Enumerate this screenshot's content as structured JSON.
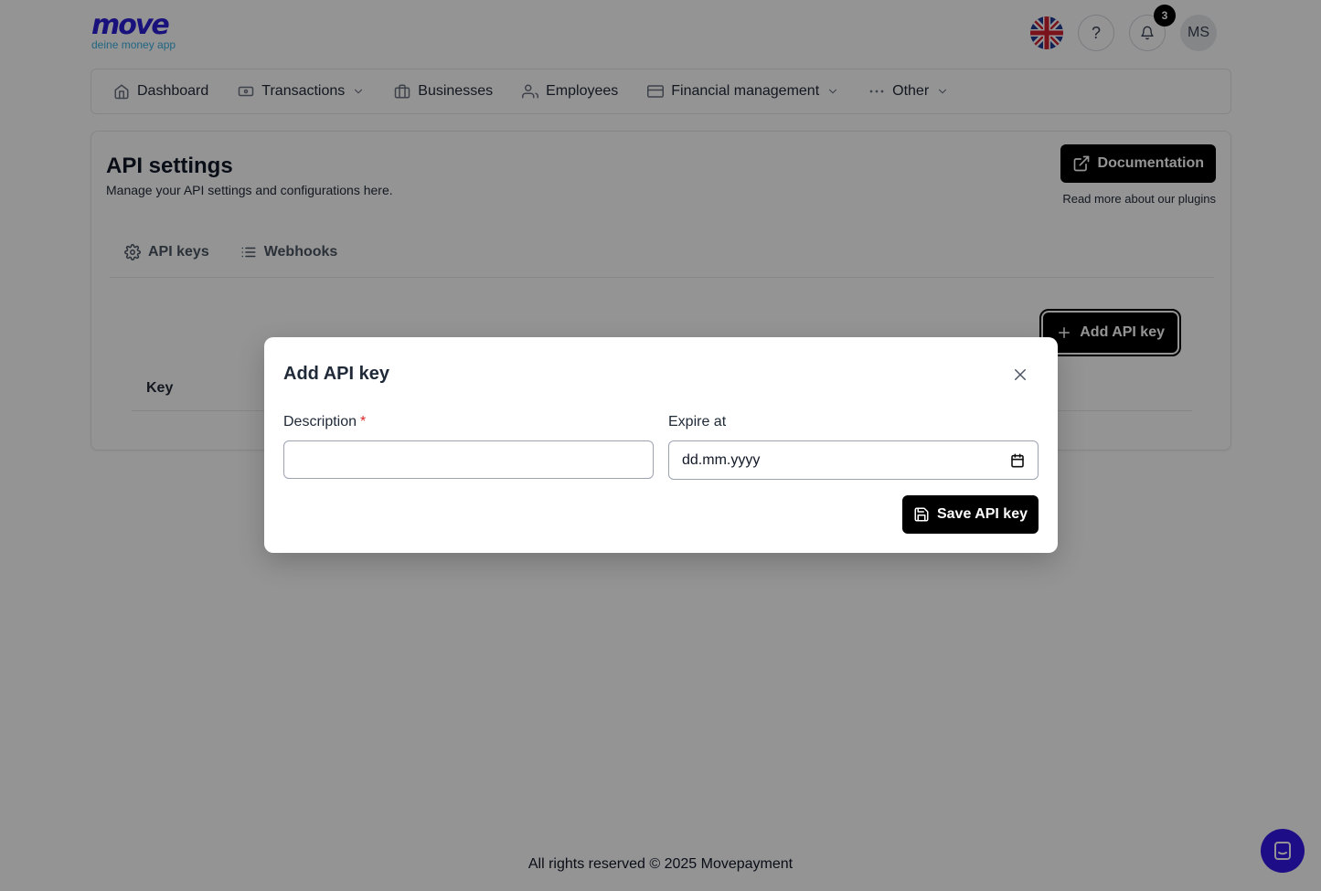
{
  "brand": {
    "name": "move",
    "tagline": "deine money app"
  },
  "header": {
    "language_icon": "uk-flag-icon",
    "help_label": "?",
    "notifications_count": "3",
    "avatar_initials": "MS"
  },
  "nav": {
    "items": [
      {
        "label": "Dashboard",
        "icon": "home-icon"
      },
      {
        "label": "Transactions",
        "icon": "banknote-icon"
      },
      {
        "label": "Businesses",
        "icon": "briefcase-icon"
      },
      {
        "label": "Employees",
        "icon": "users-icon"
      },
      {
        "label": "Financial management",
        "icon": "credit-card-icon"
      },
      {
        "label": "Other",
        "icon": "more-horizontal-icon"
      }
    ]
  },
  "page": {
    "title": "API settings",
    "subtitle": "Manage your API settings and configurations here.",
    "documentation_label": "Documentation",
    "documentation_hint": "Read more about our plugins",
    "tabs": [
      {
        "label": "API keys",
        "icon": "gear-icon"
      },
      {
        "label": "Webhooks",
        "icon": "list-icon"
      }
    ],
    "add_button_label": "Add API key",
    "table": {
      "columns": [
        "Key"
      ]
    }
  },
  "modal": {
    "title": "Add API key",
    "description_label": "Description",
    "description_required_mark": "*",
    "description_value": "",
    "expire_label": "Expire at",
    "expire_placeholder": "dd.mm.yyyy",
    "save_label": "Save API key"
  },
  "footer": {
    "text": "All rights reserved © 2025 Movepayment"
  },
  "colors": {
    "brand_primary": "#2e1fd6",
    "brand_secondary": "#3ab0e0",
    "chat_button": "#3219e8",
    "required": "#dc2626"
  }
}
